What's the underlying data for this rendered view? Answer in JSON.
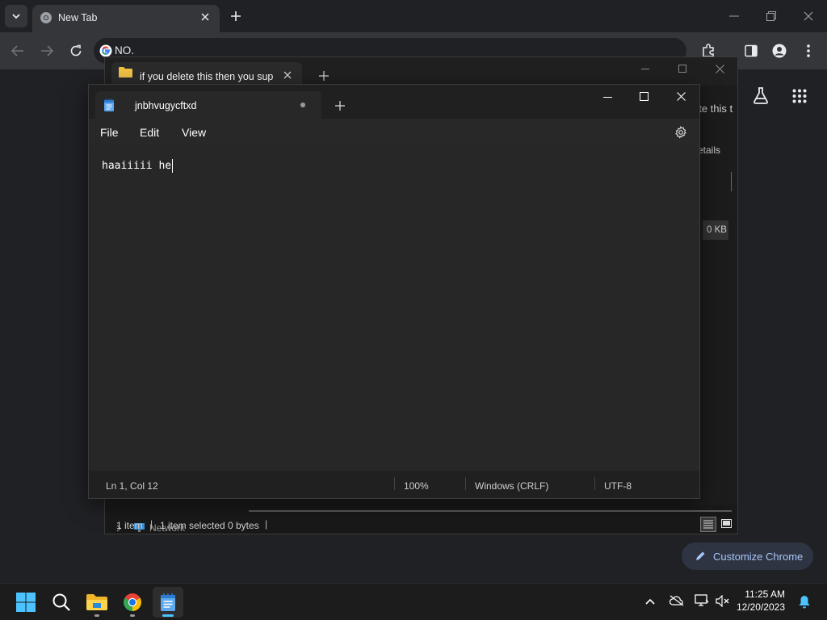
{
  "chrome": {
    "tab_title": "New Tab",
    "omnibox_text": "NO.",
    "customize_label": "Customize Chrome"
  },
  "explorer": {
    "tab_title": "if you delete this then you sup",
    "partial_title": "ete this t",
    "details_partial": "etails",
    "size_partial": "0 KB",
    "nav_network": "Network",
    "status_items": "1 item",
    "status_selected": "1 item selected",
    "status_bytes": "0 bytes"
  },
  "notepad": {
    "tab_title": "jnbhvugycftxd",
    "menu": {
      "file": "File",
      "edit": "Edit",
      "view": "View"
    },
    "content": "haaiiiii he",
    "status": {
      "position": "Ln 1, Col 12",
      "zoom": "100%",
      "line_ending": "Windows (CRLF)",
      "encoding": "UTF-8"
    }
  },
  "taskbar": {
    "time": "11:25 AM",
    "date": "12/20/2023"
  },
  "colors": {
    "accent": "#a8c7fa",
    "windows_blue": "#0078d4"
  }
}
